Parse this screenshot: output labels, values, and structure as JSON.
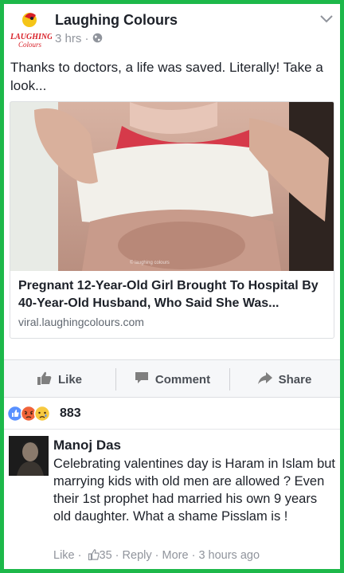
{
  "post": {
    "page_name": "Laughing Colours",
    "time": "3 hrs",
    "separator": "·",
    "text": "Thanks to doctors, a life was saved. Literally! Take a look...",
    "logo_label_1": "LAUGHING",
    "logo_label_2": "Colours"
  },
  "card": {
    "title": "Pregnant 12-Year-Old Girl Brought To Hospital By 40-Year-Old Husband, Who Said She Was...",
    "domain": "viral.laughingcolours.com"
  },
  "actions": {
    "like": "Like",
    "comment": "Comment",
    "share": "Share"
  },
  "reactions": {
    "count": "883"
  },
  "comment": {
    "author": "Manoj Das",
    "text": "Celebrating valentines day is Haram in Islam but marrying kids with old men are allowed ? Even their 1st prophet had married his own 9 years old daughter. What a shame Pisslam is !",
    "like": "Like",
    "sep1": " · ",
    "likes": "35",
    "sep2": " · ",
    "reply": "Reply",
    "sep3": " · ",
    "more": "More",
    "sep4": " · ",
    "time": "3 hours ago"
  },
  "colors": {
    "border_green": "#1db84a",
    "like_blue": "#5890ff",
    "angry_orange": "#f0633a",
    "sad_yellow": "#f7c940"
  }
}
